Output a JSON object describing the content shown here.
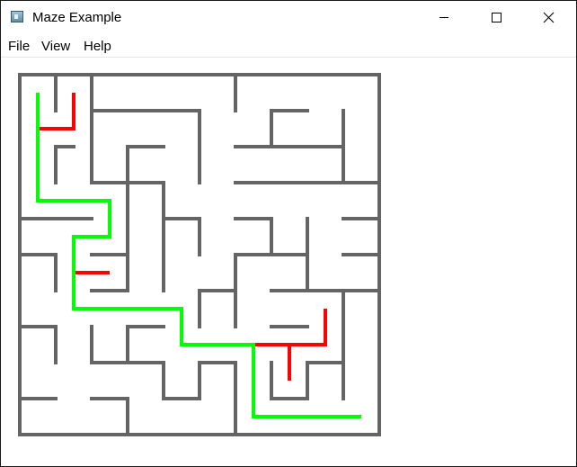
{
  "window": {
    "title": "Maze Example",
    "icon": "app-window-icon"
  },
  "caption_buttons": {
    "minimize_icon": "minimize-icon",
    "maximize_icon": "maximize-icon",
    "close_icon": "close-icon"
  },
  "menu": {
    "items": [
      {
        "label": "File"
      },
      {
        "label": "View"
      },
      {
        "label": "Help"
      }
    ]
  },
  "maze": {
    "wall_color": "#646464",
    "solution_path_color": "#00ff00",
    "dead_end_path_color": "#ff0000"
  }
}
